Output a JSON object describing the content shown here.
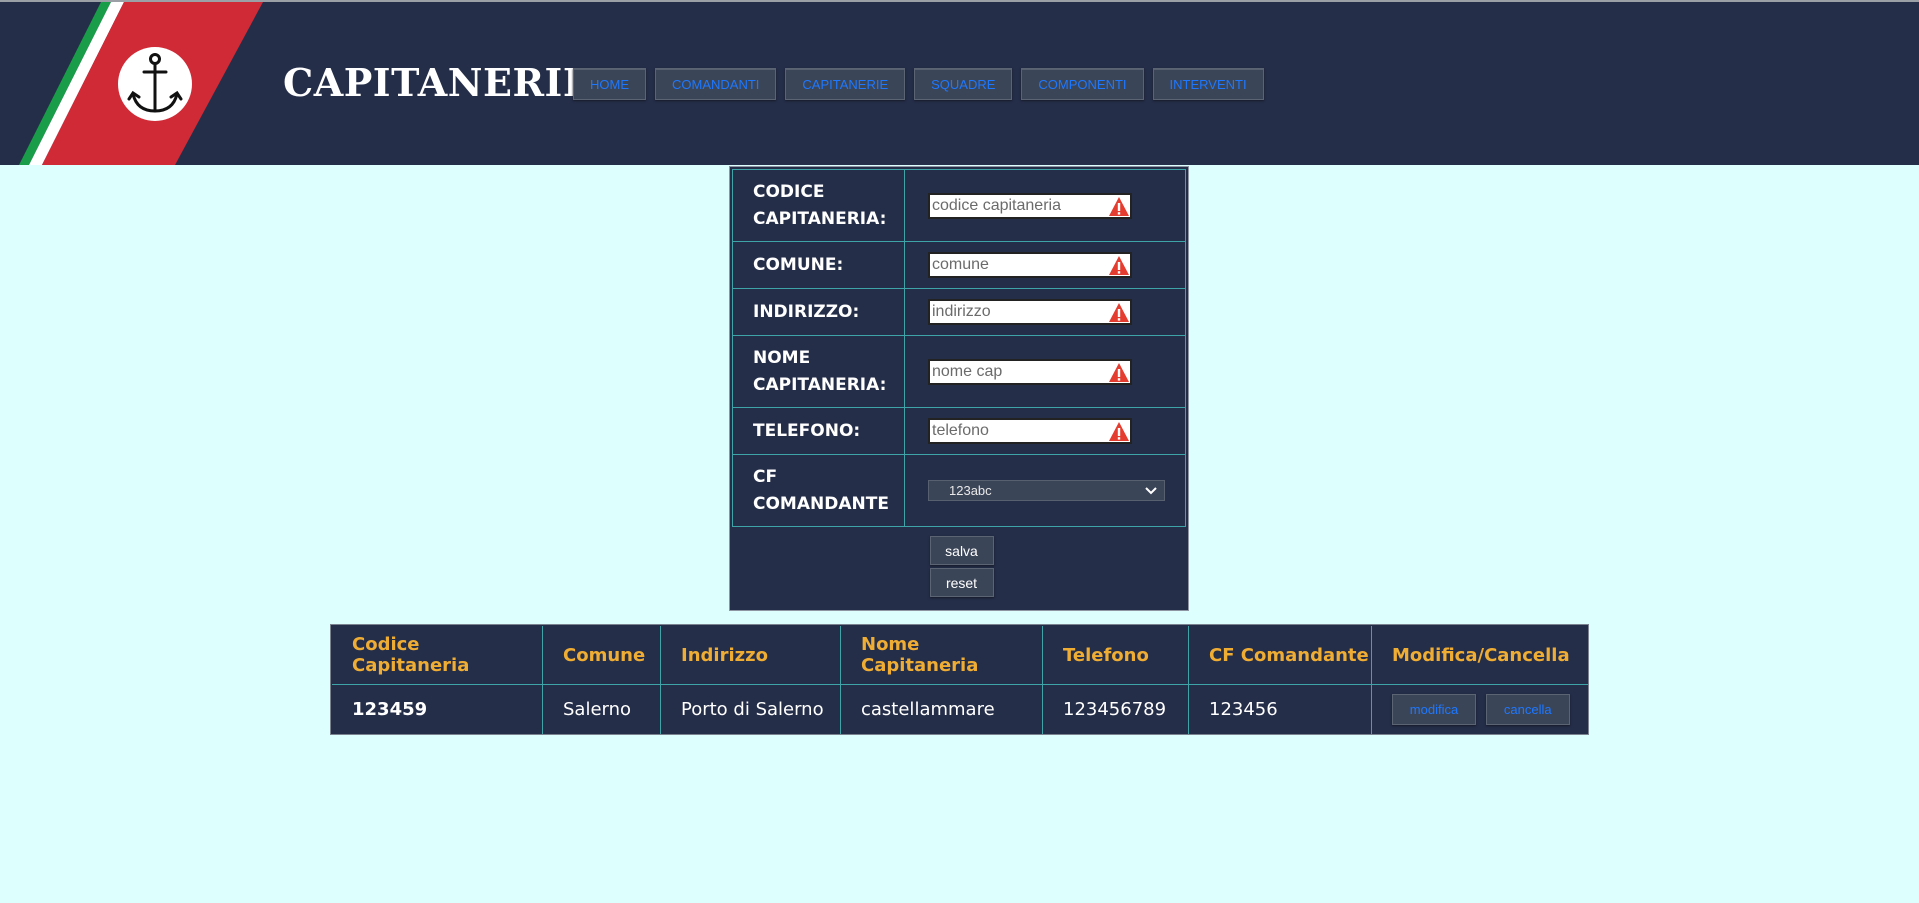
{
  "header": {
    "title": "CAPITANERIE",
    "nav": [
      "HOME",
      "COMANDANTI",
      "CAPITANERIE",
      "SQUADRE",
      "COMPONENTI",
      "INTERVENTI"
    ]
  },
  "form": {
    "fields": [
      {
        "label": "CODICE CAPITANERIA:",
        "placeholder": "codice capitaneria"
      },
      {
        "label": "COMUNE:",
        "placeholder": "comune"
      },
      {
        "label": "INDIRIZZO:",
        "placeholder": "indirizzo"
      },
      {
        "label": "NOME CAPITANERIA:",
        "placeholder": "nome cap"
      },
      {
        "label": "TELEFONO:",
        "placeholder": "telefono"
      }
    ],
    "select": {
      "label": "CF COMANDANTE",
      "value": "123abc"
    },
    "save_label": "salva",
    "reset_label": "reset"
  },
  "table": {
    "headers": [
      "Codice Capitaneria",
      "Comune",
      "Indirizzo",
      "Nome Capitaneria",
      "Telefono",
      "CF Comandante",
      "Modifica/Cancella"
    ],
    "rows": [
      {
        "codice": "123459",
        "comune": "Salerno",
        "indirizzo": "Porto di Salerno",
        "nome": "castellammare",
        "telefono": "123456789",
        "cf": "123456"
      }
    ],
    "edit_label": "modifica",
    "delete_label": "cancella"
  },
  "colors": {
    "header_bg": "#252e49",
    "page_bg": "#ddfffe",
    "header_text": "#f0ad33",
    "nav_text": "#1e78ff",
    "stripe_red": "#cf2a36",
    "stripe_green": "#1a9d48"
  },
  "icons": {
    "logo": "anchor-icon",
    "warning": "warning-icon",
    "select": "chevron-down-icon"
  }
}
